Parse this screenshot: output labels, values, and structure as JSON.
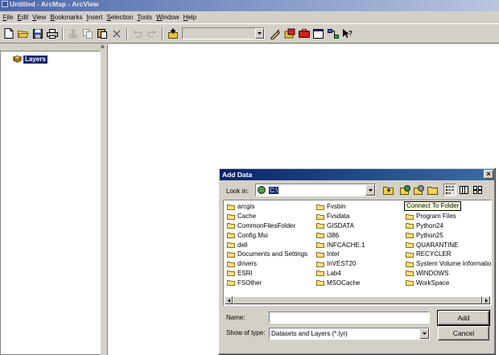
{
  "window": {
    "title": "Untitled - ArcMap - ArcView"
  },
  "menubar": {
    "items": [
      "File",
      "Edit",
      "View",
      "Bookmarks",
      "Insert",
      "Selection",
      "Tools",
      "Window",
      "Help"
    ]
  },
  "toolbar": {
    "scale_value": "",
    "icons": [
      "new-document-icon",
      "open-folder-icon",
      "save-icon",
      "print-icon",
      "cut-icon",
      "copy-icon",
      "paste-icon",
      "delete-icon",
      "undo-icon",
      "redo-icon",
      "add-data-icon",
      "editor-toolbar-icon",
      "arcatalog-icon",
      "arctoolbox-icon",
      "command-line-icon",
      "model-builder-icon",
      "whats-this-icon"
    ]
  },
  "toc": {
    "close_glyph": "×",
    "root_label": "Layers"
  },
  "dialog": {
    "title": "Add Data",
    "close_glyph": "×",
    "look_in_label": "Look in:",
    "look_in_value": "C:\\",
    "tooltip": "Connect To Folder",
    "columns": [
      [
        "arcgis",
        "Cache",
        "CommonFilesFolder",
        "Config.Msi",
        "dell",
        "Documents and Settings",
        "drivers",
        "ESRI",
        "FSOther"
      ],
      [
        "Fvsbin",
        "Fvsdata",
        "GISDATA",
        "i386",
        "INFCACHE.1",
        "Intel",
        "InVEST20",
        "Lab4",
        "MSOCache"
      ],
      [
        "",
        "Program Files",
        "Python24",
        "Python25",
        "QUARANTINE",
        "RECYCLER",
        "System Volume Information",
        "WINDOWS",
        "WorkSpace"
      ]
    ],
    "name_label": "Name:",
    "name_value": "",
    "type_label": "Show of type:",
    "type_value": "Datasets and Layers (*.lyr)",
    "add_label": "Add",
    "cancel_label": "Cancel"
  },
  "colors": {
    "title_active": "#0a246a",
    "title_inactive": "#4e68a8",
    "face": "#d4d0c8",
    "folder_yellow": "#f7e08a"
  }
}
